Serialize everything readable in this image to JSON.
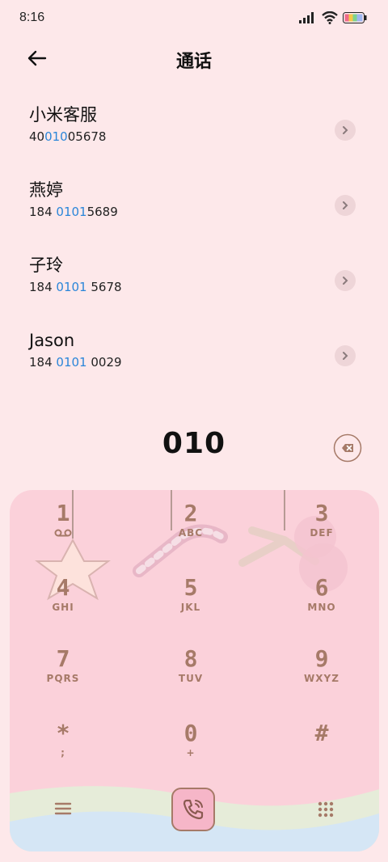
{
  "status": {
    "time": "8:16"
  },
  "header": {
    "title": "通话"
  },
  "contacts": [
    {
      "name": "小米客服",
      "number_pre": "40",
      "number_hl": "010",
      "number_post": "05678"
    },
    {
      "name": "燕婷",
      "number_pre": "184 ",
      "number_hl": "0101",
      "number_post": "5689"
    },
    {
      "name": "子玲",
      "number_pre": "184 ",
      "number_hl": "0101",
      "number_post": " 5678"
    },
    {
      "name": "Jason",
      "number_pre": "184 ",
      "number_hl": "0101",
      "number_post": " 0029"
    }
  ],
  "dialer": {
    "input": "010"
  },
  "keys": [
    {
      "digit": "1",
      "letters": ""
    },
    {
      "digit": "2",
      "letters": "ABC"
    },
    {
      "digit": "3",
      "letters": "DEF"
    },
    {
      "digit": "4",
      "letters": "GHI"
    },
    {
      "digit": "5",
      "letters": "JKL"
    },
    {
      "digit": "6",
      "letters": "MNO"
    },
    {
      "digit": "7",
      "letters": "PQRS"
    },
    {
      "digit": "8",
      "letters": "TUV"
    },
    {
      "digit": "9",
      "letters": "WXYZ"
    },
    {
      "digit": "*",
      "letters": ";"
    },
    {
      "digit": "0",
      "letters": "+"
    },
    {
      "digit": "#",
      "letters": ""
    }
  ],
  "colors": {
    "background": "#fde8ea",
    "keypad": "#fbd1da",
    "highlight": "#2b86d9",
    "key_text": "#a67a68"
  },
  "icons": [
    "wifi-icon",
    "signal-icon",
    "battery-icon",
    "back-arrow-icon",
    "chevron-right-icon",
    "backspace-icon",
    "voicemail-icon",
    "call-icon",
    "menu-icon",
    "dialpad-grid-icon"
  ]
}
